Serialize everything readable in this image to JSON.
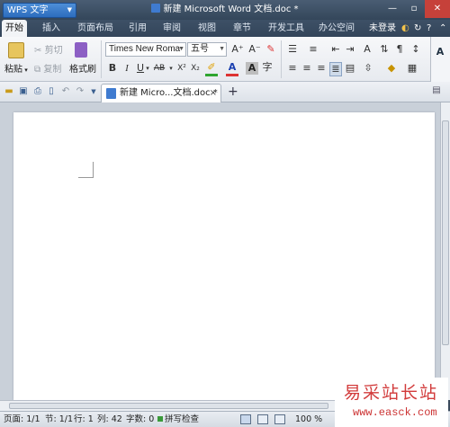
{
  "titlebar": {
    "app_menu": "WPS 文字",
    "doc_title": "新建 Microsoft Word 文档.doc *",
    "controls": [
      "—",
      "▫",
      "✕"
    ]
  },
  "menu_tabs": [
    "开始",
    "插入",
    "页面布局",
    "引用",
    "审阅",
    "视图",
    "章节",
    "开发工具",
    "办公空间"
  ],
  "menu_right": {
    "login": "未登录"
  },
  "ribbon": {
    "paste": "粘贴",
    "cut": "剪切",
    "copy": "复制",
    "format_painter": "格式刷",
    "font_name": "Times New Roma",
    "font_size": "五号",
    "bold": "B",
    "italic": "I",
    "underline": "U",
    "strike": "AB",
    "superscript": "X²",
    "subscript": "X₂",
    "font_color": "A",
    "char_shade": "A",
    "grow_font": "A⁺",
    "shrink_font": "A⁻"
  },
  "document_tab": {
    "label": "新建 Micro...文档.doc *",
    "close": "×",
    "new_tab": "+"
  },
  "statusbar": {
    "page": "页面: 1/1",
    "section": "节: 1/1",
    "row": "行: 1",
    "column": "列: 42",
    "words": "字数: 0",
    "spell": "拼写检查",
    "zoom": "100 %"
  },
  "watermark": {
    "cn": "易采站长站",
    "url": "www.easck.com"
  },
  "colors": {
    "titlebar": "#3a4c61",
    "active_tab": "#f2f4f7",
    "accent": "#2d6cbd",
    "close_button": "#c6413a"
  }
}
